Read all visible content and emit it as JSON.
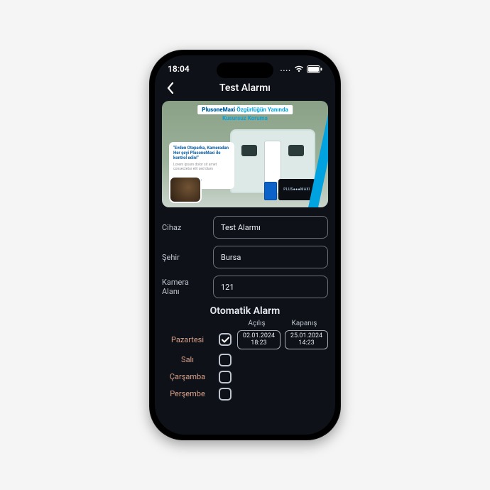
{
  "status": {
    "time": "18:04"
  },
  "nav": {
    "title": "Test Alarmı"
  },
  "promo": {
    "brand": "PlusoneMaxi",
    "headline": "Özgürlüğün Yanında",
    "subline": "Kusursuz Koruma",
    "bubble_h": "\"Evden Otoparka, Kameradan Her şeyi PlusoneMaxi ile kontrol edin!\"",
    "device_text": "PLUS●●●MAXI"
  },
  "form": {
    "cihaz_label": "Cihaz",
    "cihaz_value": "Test Alarmı",
    "sehir_label": "Şehir",
    "sehir_value": "Bursa",
    "kamera_label": "Kamera Alanı",
    "kamera_value": "121"
  },
  "schedule": {
    "section_title": "Otomatik Alarm",
    "col_open": "Açılış",
    "col_close": "Kapanış",
    "days": {
      "mon": "Pazartesi",
      "tue": "Salı",
      "wed": "Çarşamba",
      "thu": "Perşembe"
    },
    "mon_open_date": "02.01.2024",
    "mon_open_time": "18:23",
    "mon_close_date": "25.01.2024",
    "mon_close_time": "14:23"
  }
}
